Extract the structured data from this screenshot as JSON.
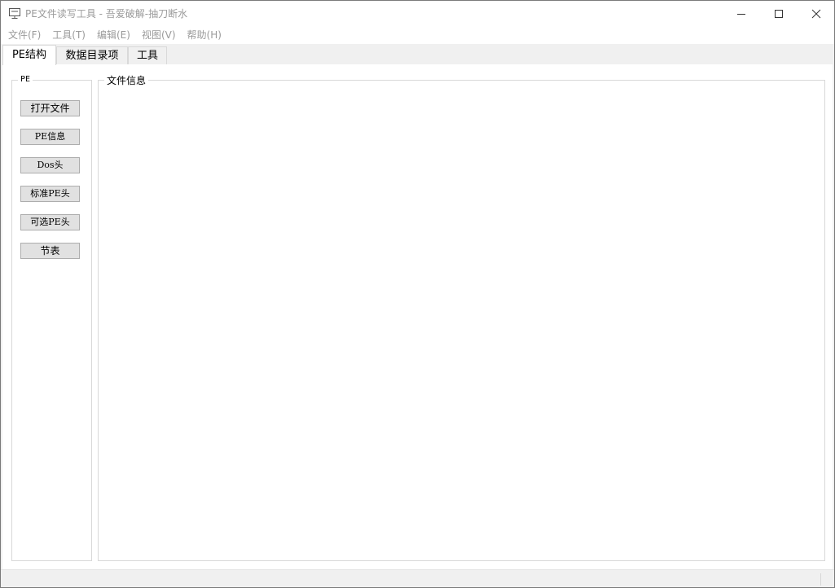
{
  "window": {
    "title": "PE文件读写工具 - 吾爱破解-抽刀断水",
    "icon": "monitor-icon"
  },
  "menu": {
    "items": [
      "文件(F)",
      "工具(T)",
      "编辑(E)",
      "视图(V)",
      "帮助(H)"
    ]
  },
  "tabs": [
    "PE结构",
    "数据目录项",
    "工具"
  ],
  "active_tab": 0,
  "left_group": {
    "caption": "PE",
    "buttons": [
      "打开文件",
      "PE信息",
      "Dos头",
      "标准PE头",
      "可选PE头",
      "节表"
    ]
  },
  "right_group": {
    "caption": "文件信息"
  },
  "colors": {
    "window_bg": "#f0f0f0",
    "button_bg": "#e1e1e1",
    "title_text": "#9a9a9a"
  }
}
